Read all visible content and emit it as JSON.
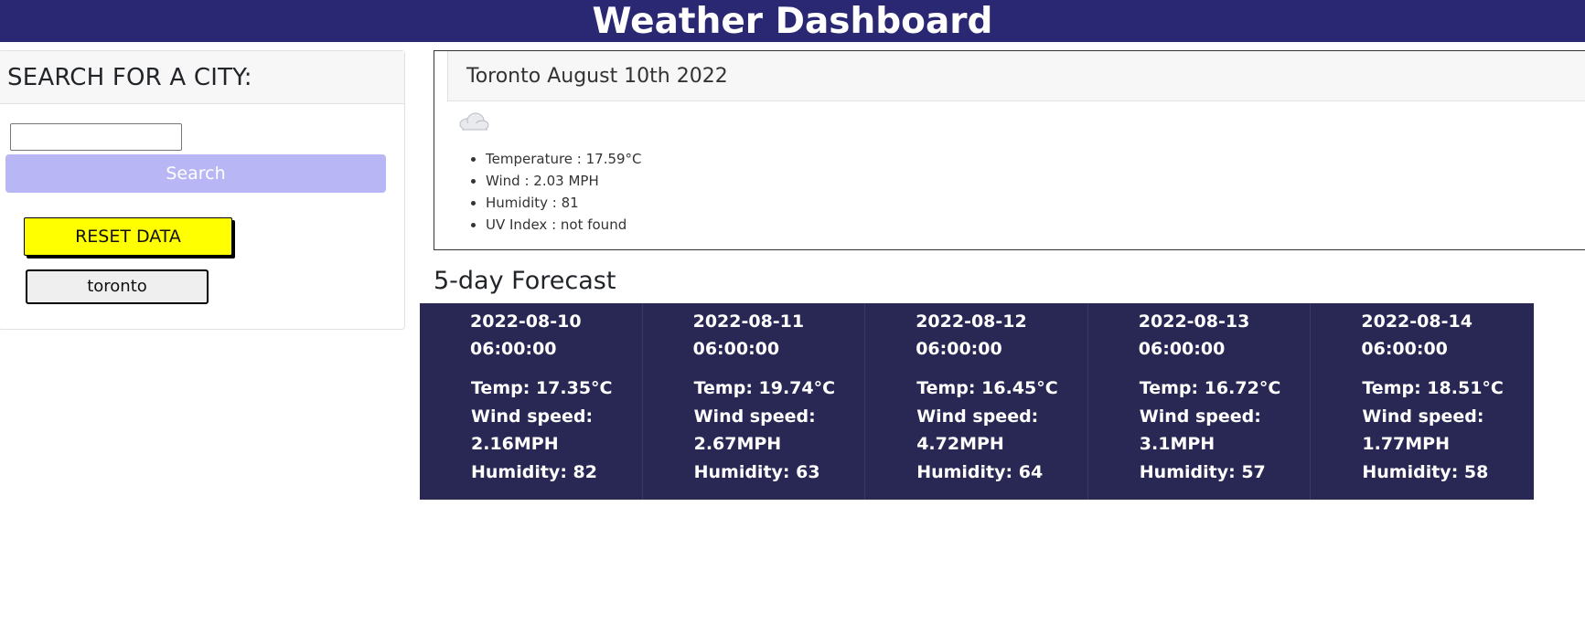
{
  "header": {
    "title": "Weather Dashboard"
  },
  "search": {
    "heading": "SEARCH FOR A CITY:",
    "input_value": "",
    "input_placeholder": "",
    "search_label": "Search",
    "reset_label": "RESET DATA",
    "history": [
      "toronto"
    ]
  },
  "current": {
    "title": "Toronto August 10th 2022",
    "icon": "cloud-icon",
    "details": [
      "Temperature : 17.59°C",
      "Wind : 2.03 MPH",
      "Humidity : 81",
      "UV Index : not found"
    ]
  },
  "forecast": {
    "title": "5-day Forecast",
    "days": [
      {
        "date": "2022-08-10",
        "time": "06:00:00",
        "temp": "Temp: 17.35°C",
        "wind_label": "Wind speed:",
        "wind": "2.16MPH",
        "humidity": "Humidity: 82"
      },
      {
        "date": "2022-08-11",
        "time": "06:00:00",
        "temp": "Temp: 19.74°C",
        "wind_label": "Wind speed:",
        "wind": "2.67MPH",
        "humidity": "Humidity: 63"
      },
      {
        "date": "2022-08-12",
        "time": "06:00:00",
        "temp": "Temp: 16.45°C",
        "wind_label": "Wind speed:",
        "wind": "4.72MPH",
        "humidity": "Humidity: 64"
      },
      {
        "date": "2022-08-13",
        "time": "06:00:00",
        "temp": "Temp: 16.72°C",
        "wind_label": "Wind speed:",
        "wind": "3.1MPH",
        "humidity": "Humidity: 57"
      },
      {
        "date": "2022-08-14",
        "time": "06:00:00",
        "temp": "Temp: 18.51°C",
        "wind_label": "Wind speed:",
        "wind": "1.77MPH",
        "humidity": "Humidity: 58"
      }
    ]
  },
  "colors": {
    "header_bg": "#2a2773",
    "search_button_bg": "#b8b6f5",
    "reset_button_bg": "#ffff00",
    "forecast_bg": "#292855"
  }
}
